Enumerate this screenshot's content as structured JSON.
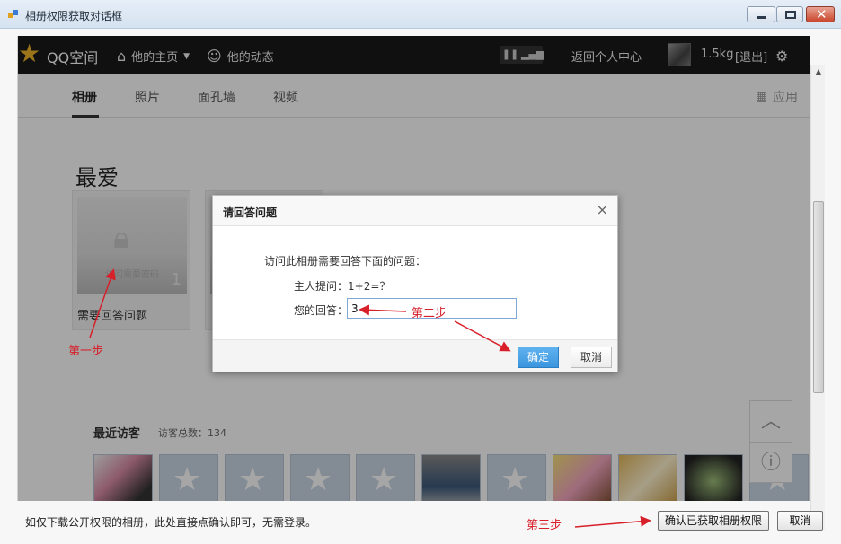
{
  "window": {
    "title": "相册权限获取对话框",
    "icon": "app-icon",
    "controls": {
      "min": "minimize-icon",
      "max": "maximize-icon",
      "close": "✕"
    }
  },
  "navbar": {
    "logo": "QQ空间",
    "home": "他的主页",
    "feed": "他的动态",
    "back_center": "返回个人中心",
    "weight": "1.5kg",
    "logout": "[退出]"
  },
  "tabs": [
    {
      "label": "相册"
    },
    {
      "label": "照片"
    },
    {
      "label": "面孔墙"
    },
    {
      "label": "视频"
    }
  ],
  "apps_label": "应用",
  "section_title": "最爱",
  "album": {
    "hint": "访问需要密码",
    "count": "1",
    "name": "需要回答问题"
  },
  "visitors": {
    "title": "最近访客",
    "count_label": "访客总数：134"
  },
  "dialog": {
    "title": "请回答问题",
    "close": "×",
    "intro": "访问此相册需要回答下面的问题：",
    "question": "主人提问：1+2=？",
    "answer_label": "您的回答：",
    "answer_value": "3",
    "ok": "确定",
    "cancel": "取消"
  },
  "annotations": {
    "step1": "第一步",
    "step2": "第二步",
    "step3": "第三步",
    "color": "#d8202b"
  },
  "footer": {
    "note": "如仅下载公开权限的相册，此处直接点确认即可，无需登录。",
    "confirm": "确认已获取相册权限",
    "cancel": "取消"
  }
}
